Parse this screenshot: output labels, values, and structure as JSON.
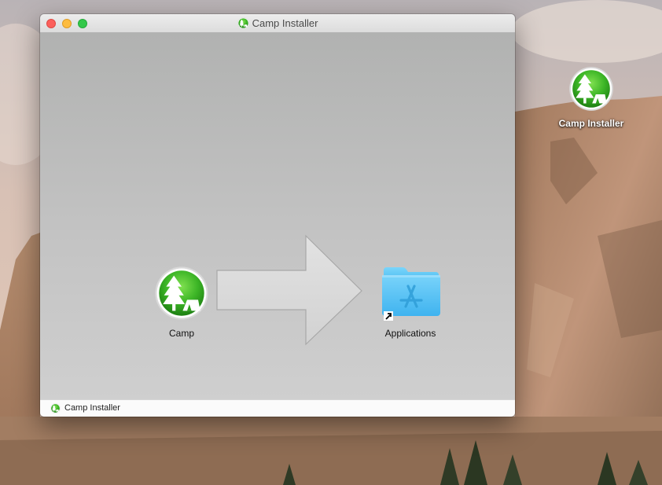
{
  "desktop": {
    "icon_label": "Camp Installer",
    "icon": "camp-app-icon"
  },
  "window": {
    "title": "Camp Installer",
    "title_icon": "camp-app-icon",
    "items": [
      {
        "label": "Camp",
        "icon": "camp-app-icon"
      },
      {
        "label": "Applications",
        "icon": "applications-folder-icon"
      }
    ],
    "arrow_icon": "drag-to-install-arrow",
    "statusbar": {
      "path_label": "Camp Installer",
      "icon": "camp-app-icon"
    }
  },
  "colors": {
    "app_green": "#2fa01d",
    "folder_blue": "#5cc7f7",
    "close": "#fc605c",
    "minimize": "#fdbc40",
    "zoom": "#34c84a"
  }
}
